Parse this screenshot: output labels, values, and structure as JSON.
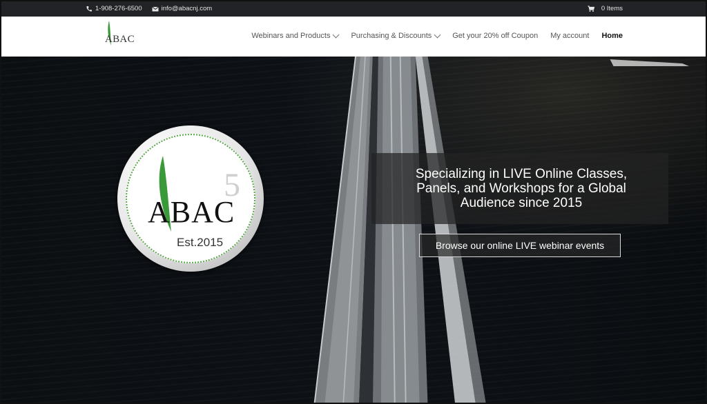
{
  "topbar": {
    "phone": "1-908-276-6500",
    "email": "info@abacnj.com",
    "cart": "0 Items"
  },
  "brand": {
    "logo_text": "ABAC"
  },
  "menu": {
    "items": [
      {
        "label": "Webinars and Products",
        "dropdown": true
      },
      {
        "label": "Purchasing & Discounts",
        "dropdown": true
      },
      {
        "label": "Get your 20% off Coupon",
        "dropdown": false
      },
      {
        "label": "My account",
        "dropdown": false
      },
      {
        "label": "Home",
        "dropdown": false,
        "active": true
      }
    ]
  },
  "hero": {
    "badge": {
      "name": "ABAC",
      "digit": "5",
      "est": "Est.2015"
    },
    "headline": "Specializing in LIVE Online Classes, Panels, and Workshops for a Global Audience since 2015",
    "cta": "Browse our online LIVE webinar events"
  },
  "colors": {
    "accent_green": "#5aa84a",
    "topbar": "#222326"
  }
}
